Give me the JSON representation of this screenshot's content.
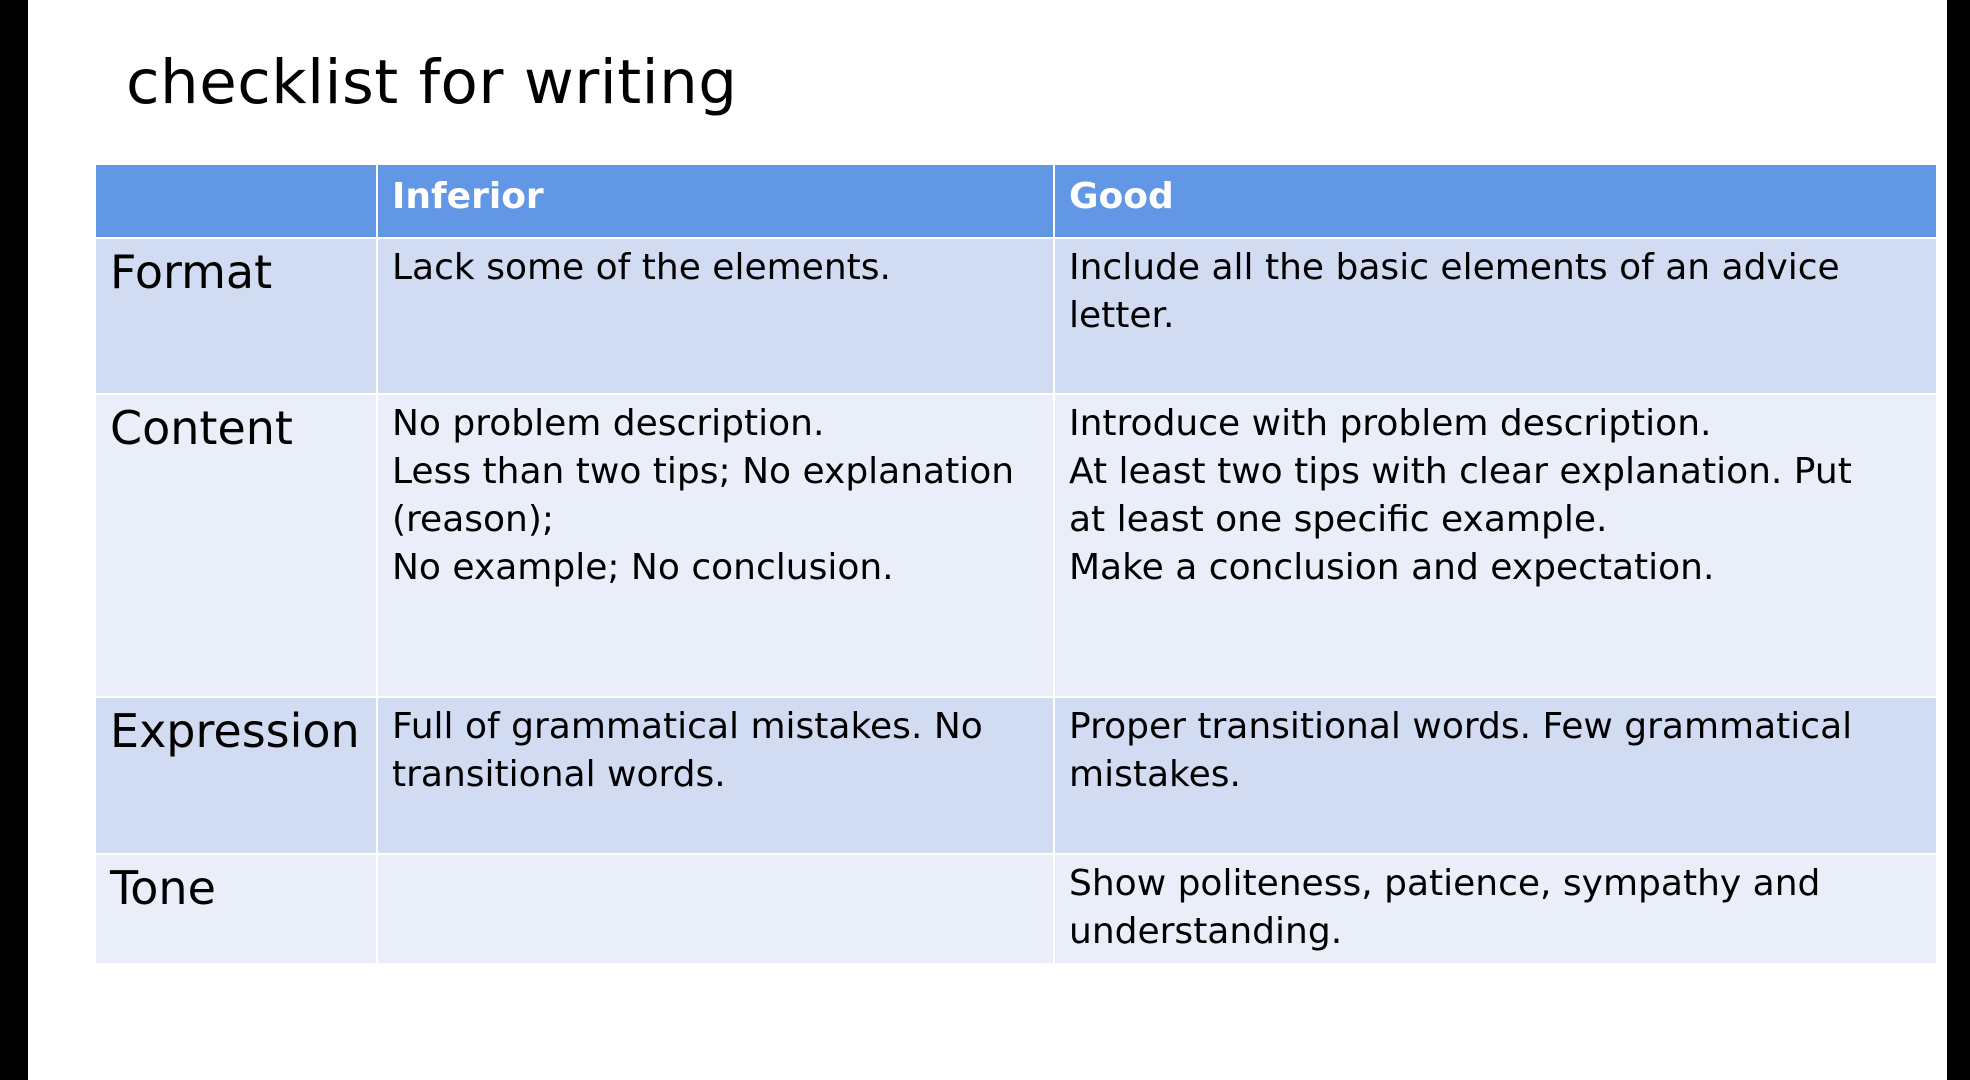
{
  "slide": {
    "title": "checklist for writing"
  },
  "colors": {
    "header_bg": "#6297e6",
    "row_dark": "#d1dcf2",
    "row_light": "#e9eef8"
  },
  "table": {
    "headers": [
      "",
      "Inferior",
      "Good"
    ],
    "rows": [
      {
        "label": "Format",
        "inferior": "Lack some of the elements.",
        "good": "Include all the basic elements of an advice\nletter."
      },
      {
        "label": "Content",
        "inferior": "No problem description.\nLess than two tips; No explanation\n(reason);\nNo example;  No conclusion.",
        "good": "Introduce with problem description.\nAt least two tips with clear explanation.  Put\nat least one specific example.\nMake a conclusion and expectation."
      },
      {
        "label": "Expression",
        "inferior": "Full of grammatical mistakes.  No\ntransitional words.",
        "good": "Proper transitional words.  Few grammatical\nmistakes."
      },
      {
        "label": "Tone",
        "inferior": "",
        "good": "Show politeness, patience, sympathy and\nunderstanding."
      }
    ]
  }
}
